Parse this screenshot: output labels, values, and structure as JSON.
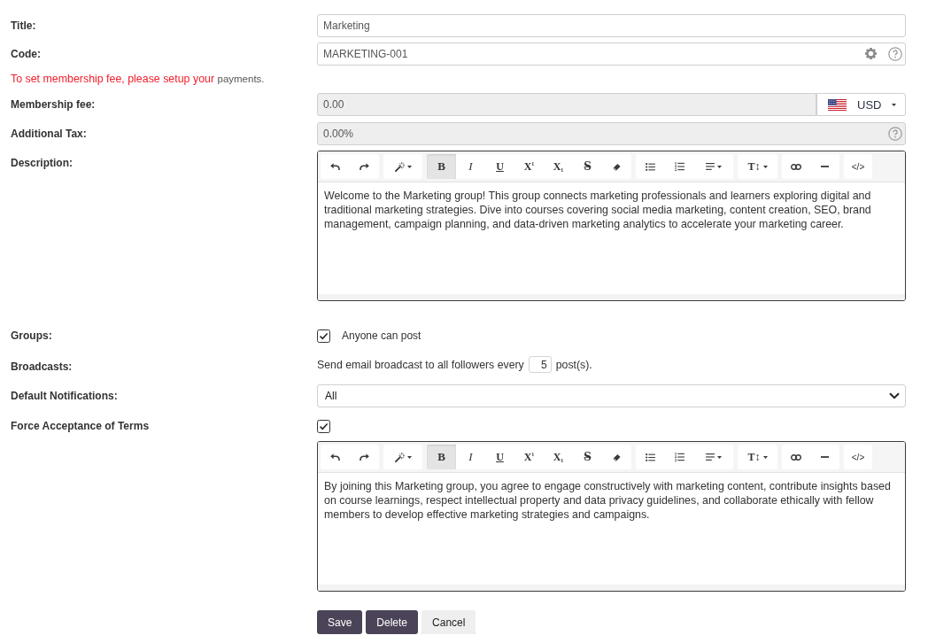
{
  "title": {
    "label": "Title:",
    "value": "Marketing"
  },
  "code": {
    "label": "Code:",
    "value": "MARKETING-001"
  },
  "payment_notice": {
    "text": "To set membership fee, please setup your",
    "link": "payments."
  },
  "membership_fee": {
    "label": "Membership fee:",
    "value": "0.00",
    "disabled": true,
    "currency": "USD"
  },
  "additional_tax": {
    "label": "Additional Tax:",
    "value": "0.00%",
    "disabled": true
  },
  "description": {
    "label": "Description:",
    "editor": {
      "toolbar": [
        {
          "buttons": [
            {
              "kind": "undo",
              "active": false
            },
            {
              "kind": "redo",
              "active": false
            }
          ]
        },
        {
          "buttons": [
            {
              "kind": "magic",
              "active": false
            }
          ]
        },
        {
          "buttons": [
            {
              "kind": "bold",
              "label": "B",
              "active": true
            },
            {
              "kind": "italic",
              "label": "I",
              "active": false
            },
            {
              "kind": "underline",
              "label": "U",
              "active": false
            },
            {
              "kind": "superscript",
              "label": "X$^{1}$",
              "active": false
            },
            {
              "kind": "subscript",
              "label": "X$_{1}$",
              "active": false
            },
            {
              "kind": "strikethrough",
              "label": "S̶",
              "active": false
            },
            {
              "kind": "eraser",
              "active": false
            }
          ]
        },
        {
          "buttons": [
            {
              "kind": "bullet-list",
              "active": false
            },
            {
              "kind": "numbered-list",
              "active": false
            },
            {
              "kind": "align",
              "active": false
            }
          ]
        },
        {
          "buttons": [
            {
              "kind": "font-size",
              "label": "T↕",
              "active": false
            }
          ]
        },
        {
          "buttons": [
            {
              "kind": "link",
              "active": false
            },
            {
              "kind": "horizontal-rule",
              "active": false
            }
          ]
        },
        {
          "buttons": [
            {
              "kind": "code-view",
              "label": "</>",
              "active": false
            }
          ]
        }
      ],
      "text": "Welcome to the Marketing group! This group connects marketing professionals and learners exploring digital and traditional marketing strategies. Dive into courses covering social media marketing, content creation, SEO, brand management, campaign planning, and data-driven marketing analytics to accelerate your marketing career."
    }
  },
  "groups": {
    "label": "Groups:",
    "checked": true,
    "option": "Anyone can post"
  },
  "broadcasts": {
    "label": "Broadcasts:",
    "text_before": "Send email broadcast to all followers every",
    "value": "5",
    "text_after": "post(s)."
  },
  "default_notifications": {
    "label": "Default Notifications:",
    "value": "All"
  },
  "force_acceptance": {
    "label": "Force Acceptance of Terms",
    "checked": true
  },
  "terms": {
    "editor": {
      "toolbar": [
        {
          "buttons": [
            {
              "kind": "undo",
              "active": false
            },
            {
              "kind": "redo",
              "active": false
            }
          ]
        },
        {
          "buttons": [
            {
              "kind": "magic",
              "active": false
            }
          ]
        },
        {
          "buttons": [
            {
              "kind": "bold",
              "label": "B",
              "active": true
            },
            {
              "kind": "italic",
              "label": "I",
              "active": false
            },
            {
              "kind": "underline",
              "label": "U",
              "active": false
            },
            {
              "kind": "superscript",
              "label": "X$^{1}$",
              "active": false
            },
            {
              "kind": "subscript",
              "label": "X$_{1}$",
              "active": false
            },
            {
              "kind": "strikethrough",
              "label": "S̶",
              "active": false
            },
            {
              "kind": "eraser",
              "active": false
            }
          ]
        },
        {
          "buttons": [
            {
              "kind": "bullet-list",
              "active": false
            },
            {
              "kind": "numbered-list",
              "active": false
            },
            {
              "kind": "align",
              "active": false
            }
          ]
        },
        {
          "buttons": [
            {
              "kind": "font-size",
              "label": "T↕",
              "active": false
            }
          ]
        },
        {
          "buttons": [
            {
              "kind": "link",
              "active": false
            },
            {
              "kind": "horizontal-rule",
              "active": false
            }
          ]
        },
        {
          "buttons": [
            {
              "kind": "code-view",
              "label": "</>",
              "active": false
            }
          ]
        }
      ],
      "text": "By joining this Marketing group, you agree to engage constructively with marketing content, contribute insights based on course learnings, respect intellectual property and data privacy guidelines, and collaborate ethically with fellow members to develop effective marketing strategies and campaigns."
    }
  },
  "buttons": [
    {
      "kind": "save",
      "label": "Save"
    },
    {
      "kind": "delete",
      "label": "Delete"
    },
    {
      "kind": "cancel",
      "label": "Cancel"
    }
  ]
}
